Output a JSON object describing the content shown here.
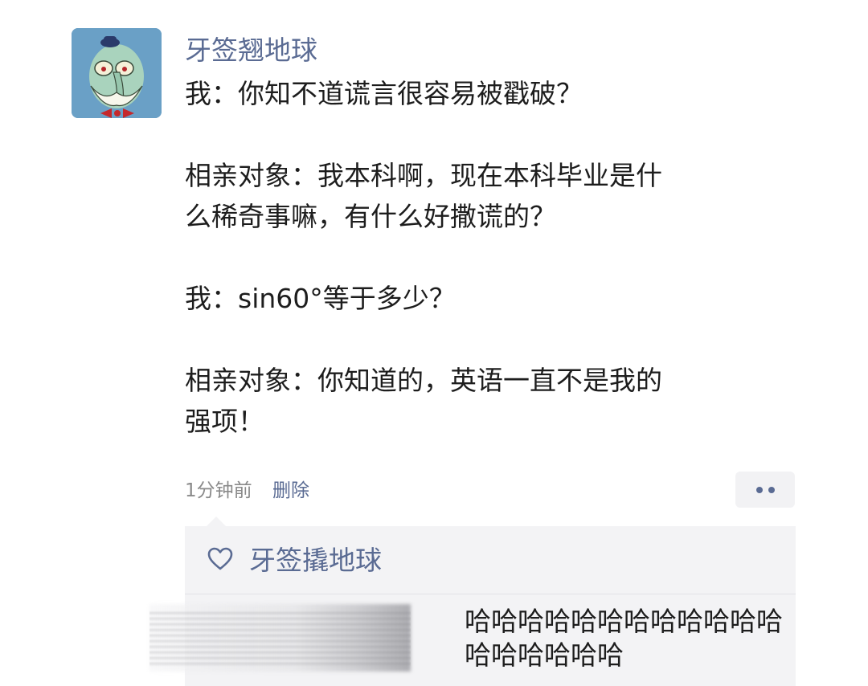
{
  "post": {
    "author": "牙签翘地球",
    "avatar_icon": "squidward-avatar-icon",
    "paragraphs": [
      [
        "我：你知不道谎言很容易被戳破？"
      ],
      [
        "相亲对象：我本科啊，现在本科毕业是什",
        "么稀奇事嘛，有什么好撒谎的？"
      ],
      [
        "我：sin60°等于多少？"
      ],
      [
        "相亲对象：你知道的，英语一直不是我的",
        "强项！"
      ]
    ],
    "time": "1分钟前",
    "delete_label": "删除",
    "more_icon": "more-dots-icon"
  },
  "comments": {
    "like_icon": "heart-outline-icon",
    "liked_by": "牙签撬地球",
    "comment_lines": [
      "哈哈哈哈哈哈哈哈哈哈哈哈",
      "哈哈哈哈哈哈"
    ]
  },
  "colors": {
    "author": "#5a6b93",
    "text": "#1d1d1d",
    "meta": "#8a8a8a",
    "comment_bg": "#f3f3f5",
    "avatar_bg": "#6aa0c6"
  }
}
